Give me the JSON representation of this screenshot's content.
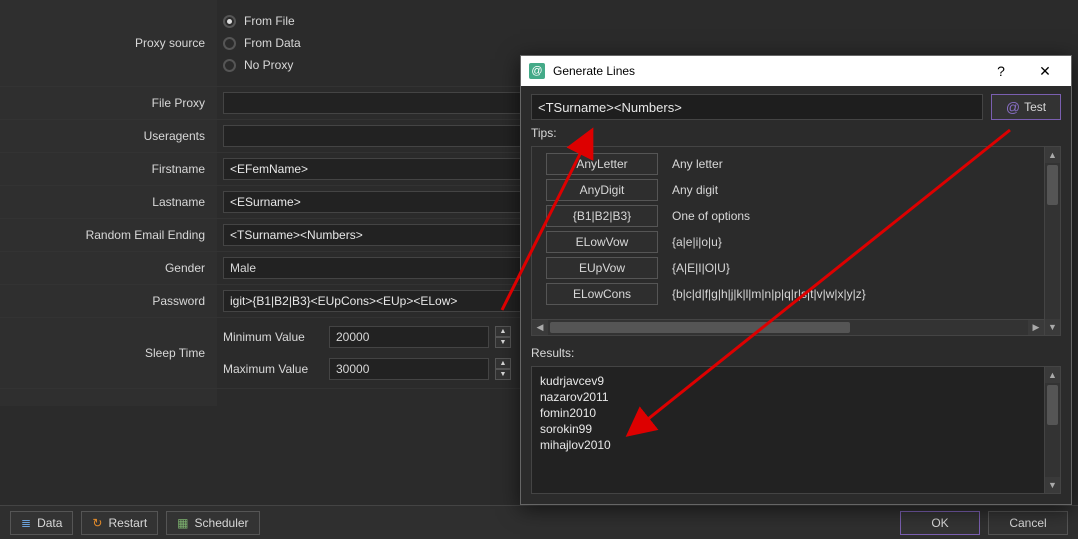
{
  "form": {
    "proxy_source": {
      "label": "Proxy source",
      "opt_file": "From File",
      "opt_data": "From Data",
      "opt_none": "No Proxy"
    },
    "file_proxy": {
      "label": "File Proxy",
      "value": ""
    },
    "useragents": {
      "label": "Useragents",
      "value": ""
    },
    "firstname": {
      "label": "Firstname",
      "value": "<EFemName>"
    },
    "lastname": {
      "label": "Lastname",
      "value": "<ESurname>"
    },
    "random_email": {
      "label": "Random Email Ending",
      "value": "<TSurname><Numbers>"
    },
    "gender": {
      "label": "Gender",
      "value": "Male"
    },
    "password": {
      "label": "Password",
      "value": "igit>{B1|B2|B3}<EUpCons><EUp><ELow>"
    },
    "sleep": {
      "label": "Sleep Time",
      "min_label": "Minimum Value",
      "min_value": "20000",
      "max_label": "Maximum Value",
      "max_value": "30000"
    }
  },
  "bottom": {
    "data": "Data",
    "restart": "Restart",
    "scheduler": "Scheduler",
    "ok": "OK",
    "cancel": "Cancel"
  },
  "dialog": {
    "title": "Generate Lines",
    "expression": "<TSurname><Numbers>",
    "test": "Test",
    "tips_label": "Tips:",
    "tips": [
      {
        "chip": "AnyLetter",
        "desc": "Any letter"
      },
      {
        "chip": "AnyDigit",
        "desc": "Any digit"
      },
      {
        "chip": "{B1|B2|B3}",
        "desc": "One of options"
      },
      {
        "chip": "ELowVow",
        "desc": "{a|e|i|o|u}"
      },
      {
        "chip": "EUpVow",
        "desc": "{A|E|I|O|U}"
      },
      {
        "chip": "ELowCons",
        "desc": "{b|c|d|f|g|h|j|k|l|m|n|p|q|r|s|t|v|w|x|y|z}"
      }
    ],
    "results_label": "Results:",
    "results": [
      "kudrjavcev9",
      "nazarov2011",
      "fomin2010",
      "sorokin99",
      "mihajlov2010"
    ]
  }
}
